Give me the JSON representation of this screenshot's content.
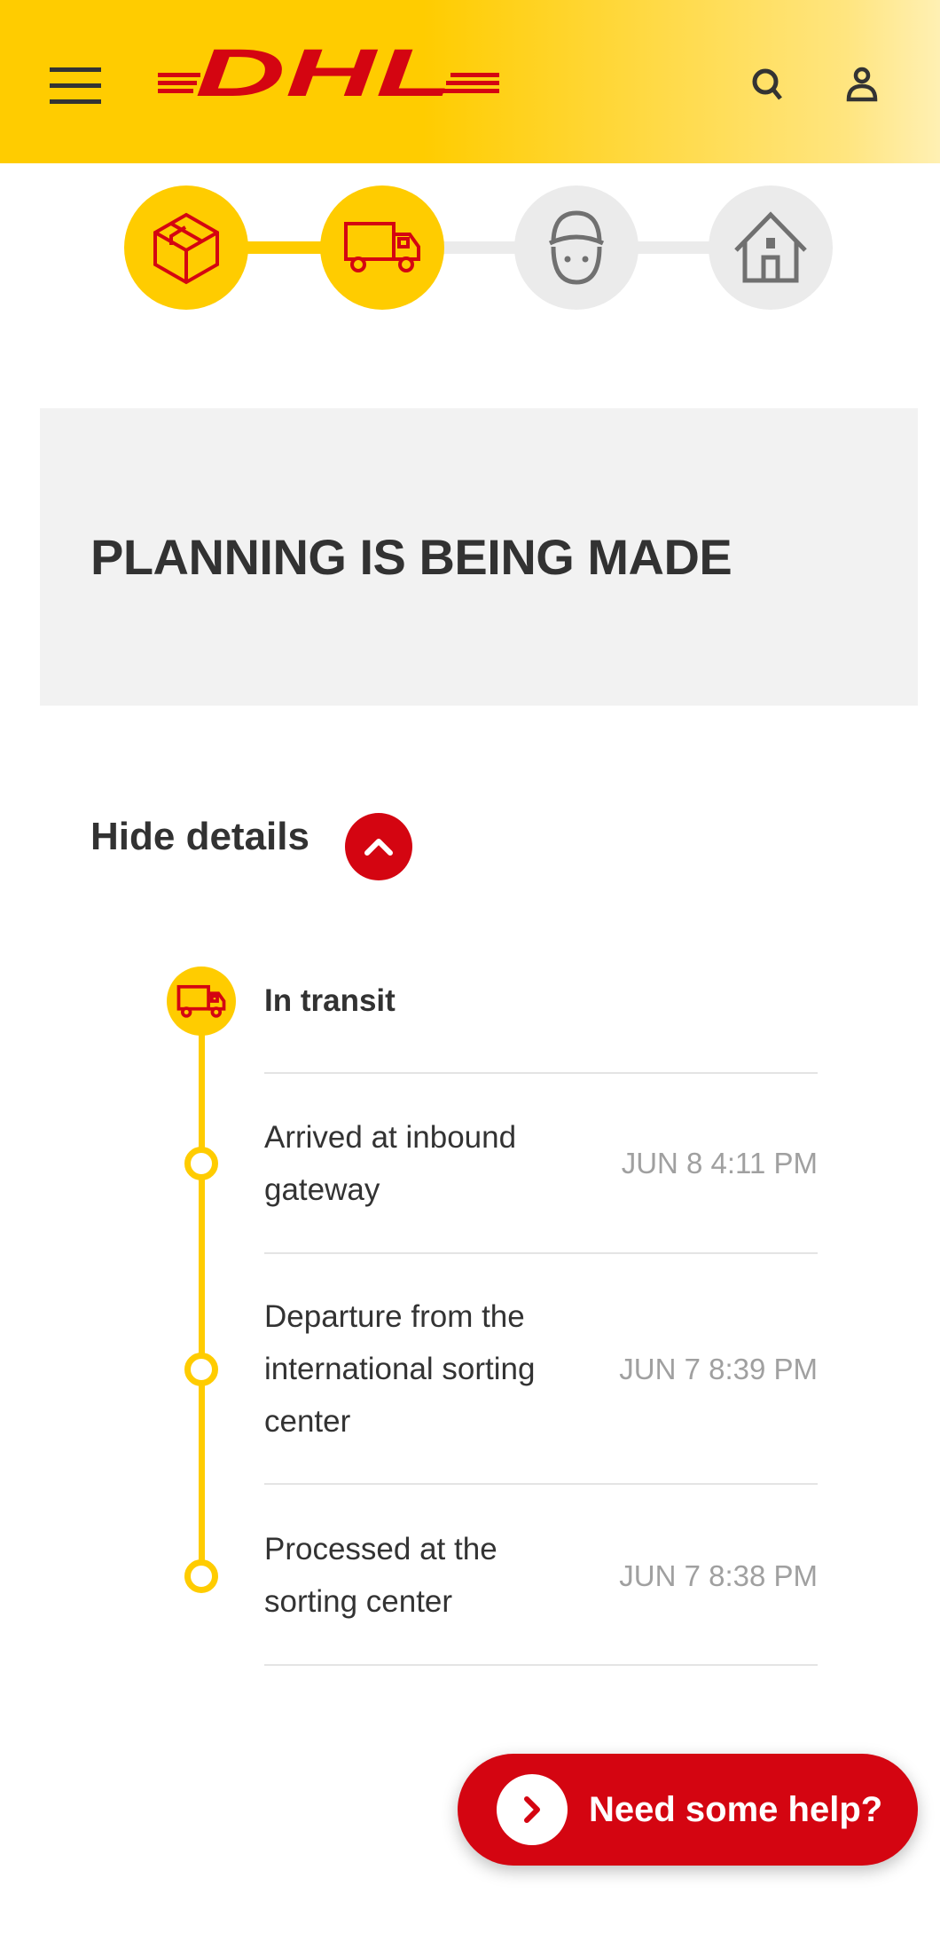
{
  "header": {
    "logo_text": "DHL",
    "menu_icon": "hamburger-icon",
    "search_icon": "search-icon",
    "account_icon": "user-icon"
  },
  "progress": {
    "steps": [
      {
        "icon": "package-icon",
        "state": "done"
      },
      {
        "icon": "truck-icon",
        "state": "done"
      },
      {
        "icon": "courier-icon",
        "state": "pending"
      },
      {
        "icon": "house-icon",
        "state": "pending"
      }
    ]
  },
  "status": {
    "title": "PLANNING IS BEING MADE"
  },
  "details": {
    "toggle_label": "Hide details"
  },
  "timeline": {
    "current": "In transit",
    "events": [
      {
        "lines": [
          "Arrived at inbound",
          "gateway"
        ],
        "date": "JUN 8 4:11 PM"
      },
      {
        "lines": [
          "Departure from the",
          "international sorting",
          "center"
        ],
        "date": "JUN 7 8:39 PM"
      },
      {
        "lines": [
          "Processed at the",
          "sorting center"
        ],
        "date": "JUN 7 8:38 PM"
      }
    ]
  },
  "help": {
    "label": "Need some help?"
  },
  "colors": {
    "yellow": "#ffcc00",
    "red": "#d40511",
    "gray": "#ebebeb"
  }
}
